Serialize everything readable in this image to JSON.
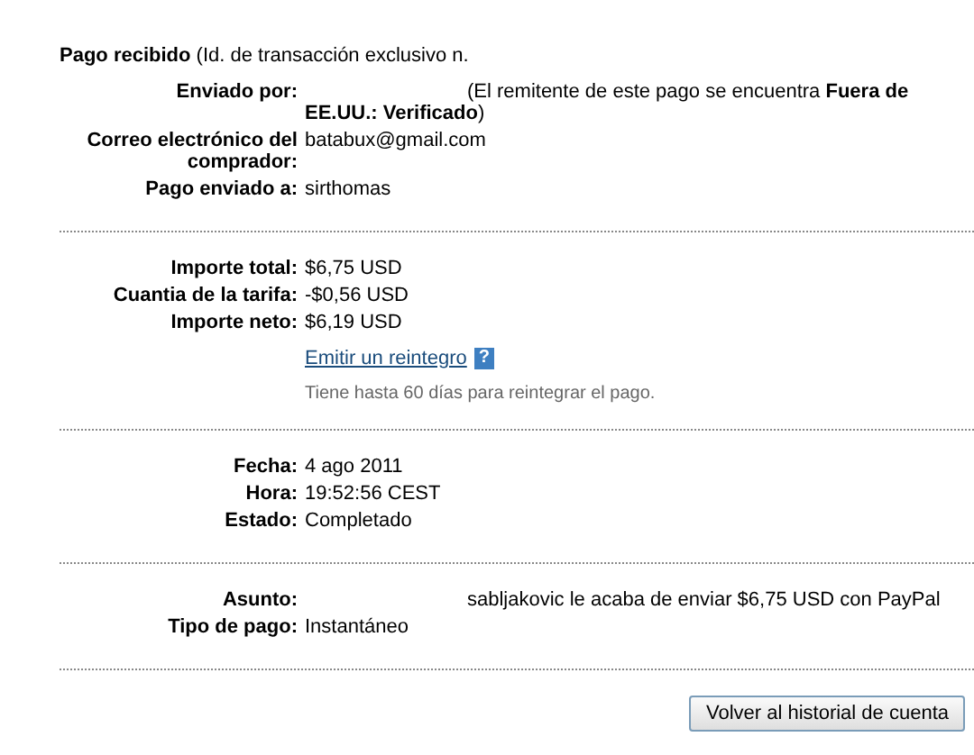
{
  "heading": "**Pago recibido** (Id. de transacción exclusivo n.",
  "sections": [
    {
      "rows": [
        {
          "label": "Enviado por:",
          "value": "(El remitente de este pago se encuentra **Fuera de EE.UU.: Verificado**)",
          "redacted": true
        },
        {
          "label": "Correo electrónico del comprador:",
          "value": "batabux@gmail.com",
          "redacted": false
        },
        {
          "label": "Pago enviado a:",
          "value": "sirthomas",
          "redacted": false
        }
      ]
    },
    {
      "rows": [
        {
          "label": "Importe total:",
          "value": "$6,75 USD",
          "redacted": false
        },
        {
          "label": "Cuantia de la tarifa:",
          "value": "-$0,56 USD",
          "redacted": false
        },
        {
          "label": "Importe neto:",
          "value": "$6,19 USD",
          "redacted": false
        }
      ],
      "refund": {
        "link": "Emitir un reintegro",
        "help": "?",
        "note": "Tiene hasta 60 días para reintegrar el pago."
      }
    },
    {
      "rows": [
        {
          "label": "Fecha:",
          "value": "4 ago 2011",
          "redacted": false
        },
        {
          "label": "Hora:",
          "value": "19:52:56 CEST",
          "redacted": false
        },
        {
          "label": "Estado:",
          "value": "Completado",
          "redacted": false
        }
      ]
    },
    {
      "rows": [
        {
          "label": "Asunto:",
          "value": "sabljakovic le acaba de enviar $6,75 USD con PayPal",
          "redacted": true
        },
        {
          "label": "Tipo de pago:",
          "value": "Instantáneo",
          "redacted": false
        }
      ]
    }
  ],
  "button": "Volver al historial de cuenta"
}
